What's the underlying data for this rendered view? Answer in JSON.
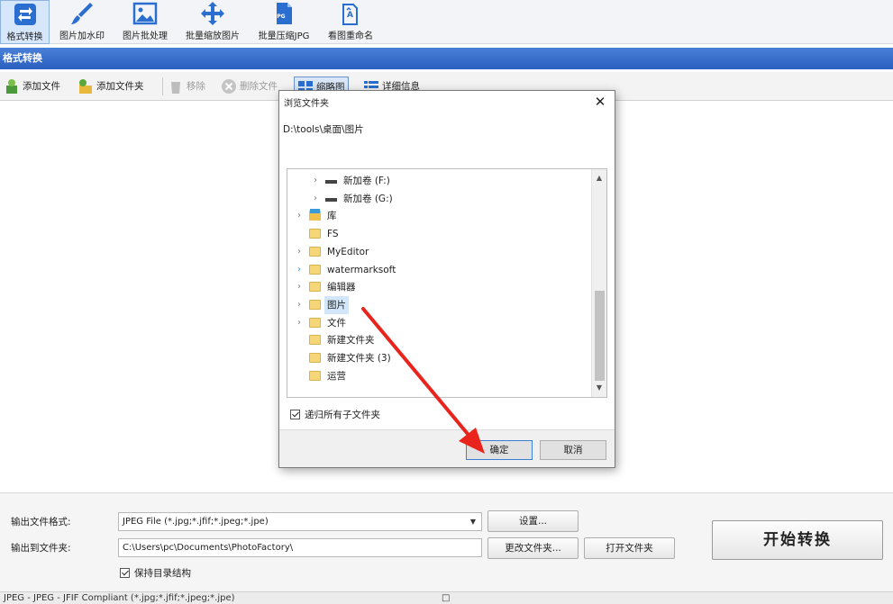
{
  "ribbon": {
    "items": [
      {
        "label": "格式转换",
        "icon": "convert-icon"
      },
      {
        "label": "图片加水印",
        "icon": "brush-icon"
      },
      {
        "label": "图片批处理",
        "icon": "picture-icon"
      },
      {
        "label": "批量缩放图片",
        "icon": "move-arrows-icon"
      },
      {
        "label": "批量压缩JPG",
        "icon": "jpg-file-icon"
      },
      {
        "label": "看图重命名",
        "icon": "rename-icon"
      }
    ],
    "jpg_badge": "JPG",
    "rename_badge": "A"
  },
  "section": {
    "title": "格式转换"
  },
  "toolbar": {
    "add_file": "添加文件",
    "add_folder": "添加文件夹",
    "remove": "移除",
    "delete_file": "删除文件",
    "thumbnail": "缩略图",
    "details": "详细信息"
  },
  "dialog": {
    "title": "浏览文件夹",
    "path": "D:\\tools\\桌面\\图片",
    "close": "✕",
    "tree": [
      {
        "label": "新加卷 (F:)",
        "type": "drive",
        "level": 2,
        "chevron": "›"
      },
      {
        "label": "新加卷 (G:)",
        "type": "drive",
        "level": 2,
        "chevron": "›"
      },
      {
        "label": "库",
        "type": "library",
        "level": 1,
        "chevron": "›"
      },
      {
        "label": "FS",
        "type": "folder",
        "level": 1,
        "chevron": ""
      },
      {
        "label": "MyEditor",
        "type": "folder",
        "level": 1,
        "chevron": "›"
      },
      {
        "label": "watermarksoft",
        "type": "folder",
        "level": 1,
        "chevron": "›"
      },
      {
        "label": "编辑器",
        "type": "folder",
        "level": 1,
        "chevron": "›"
      },
      {
        "label": "图片",
        "type": "folder",
        "level": 1,
        "chevron": "›",
        "selected": true
      },
      {
        "label": "文件",
        "type": "folder",
        "level": 1,
        "chevron": "›"
      },
      {
        "label": "新建文件夹",
        "type": "folder",
        "level": 1,
        "chevron": ""
      },
      {
        "label": "新建文件夹 (3)",
        "type": "folder",
        "level": 1,
        "chevron": ""
      },
      {
        "label": "运营",
        "type": "folder",
        "level": 1,
        "chevron": ""
      }
    ],
    "recursive_label": "递归所有子文件夹",
    "recursive_checked": true,
    "ok": "确定",
    "cancel": "取消"
  },
  "bottom": {
    "format_label": "输出文件格式:",
    "format_value": "JPEG File (*.jpg;*.jfif;*.jpeg;*.jpe)",
    "settings_button": "设置...",
    "output_label": "输出到文件夹:",
    "output_value": "C:\\Users\\pc\\Documents\\PhotoFactory\\",
    "change_folder_button": "更改文件夹...",
    "open_folder_button": "打开文件夹",
    "keep_structure_label": "保持目录结构",
    "keep_structure_checked": true,
    "start_button": "开始转换"
  },
  "status": {
    "text": "JPEG - JPEG - JFIF Compliant (*.jpg;*.jfif;*.jpeg;*.jpe)",
    "glyph": "□"
  },
  "colors": {
    "section_header": "#2b5fc1",
    "annotation_arrow": "#e8241c",
    "ribbon_blue": "#2a6fd0"
  }
}
